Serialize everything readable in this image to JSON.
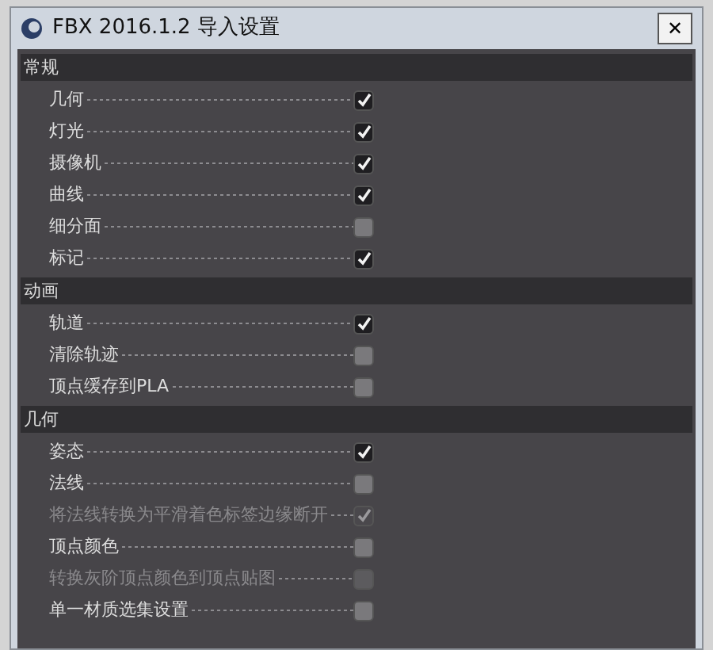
{
  "window": {
    "title": "FBX 2016.1.2 导入设置",
    "close": "✕"
  },
  "sections": [
    {
      "title": "常规",
      "options": [
        {
          "label": "几何",
          "checked": true,
          "disabled": false
        },
        {
          "label": "灯光",
          "checked": true,
          "disabled": false
        },
        {
          "label": "摄像机",
          "checked": true,
          "disabled": false
        },
        {
          "label": "曲线",
          "checked": true,
          "disabled": false
        },
        {
          "label": "细分面",
          "checked": false,
          "disabled": false
        },
        {
          "label": "标记",
          "checked": true,
          "disabled": false
        }
      ]
    },
    {
      "title": "动画",
      "options": [
        {
          "label": "轨道",
          "checked": true,
          "disabled": false
        },
        {
          "label": "清除轨迹",
          "checked": false,
          "disabled": false
        },
        {
          "label": "顶点缓存到PLA",
          "checked": false,
          "disabled": false
        }
      ]
    },
    {
      "title": "几何",
      "options": [
        {
          "label": "姿态",
          "checked": true,
          "disabled": false
        },
        {
          "label": "法线",
          "checked": false,
          "disabled": false
        },
        {
          "label": "将法线转换为平滑着色标签边缘断开",
          "checked": true,
          "disabled": true
        },
        {
          "label": "顶点颜色",
          "checked": false,
          "disabled": false
        },
        {
          "label": "转换灰阶顶点颜色到顶点贴图",
          "checked": false,
          "disabled": true
        },
        {
          "label": "单一材质选集设置",
          "checked": false,
          "disabled": false
        }
      ]
    }
  ]
}
